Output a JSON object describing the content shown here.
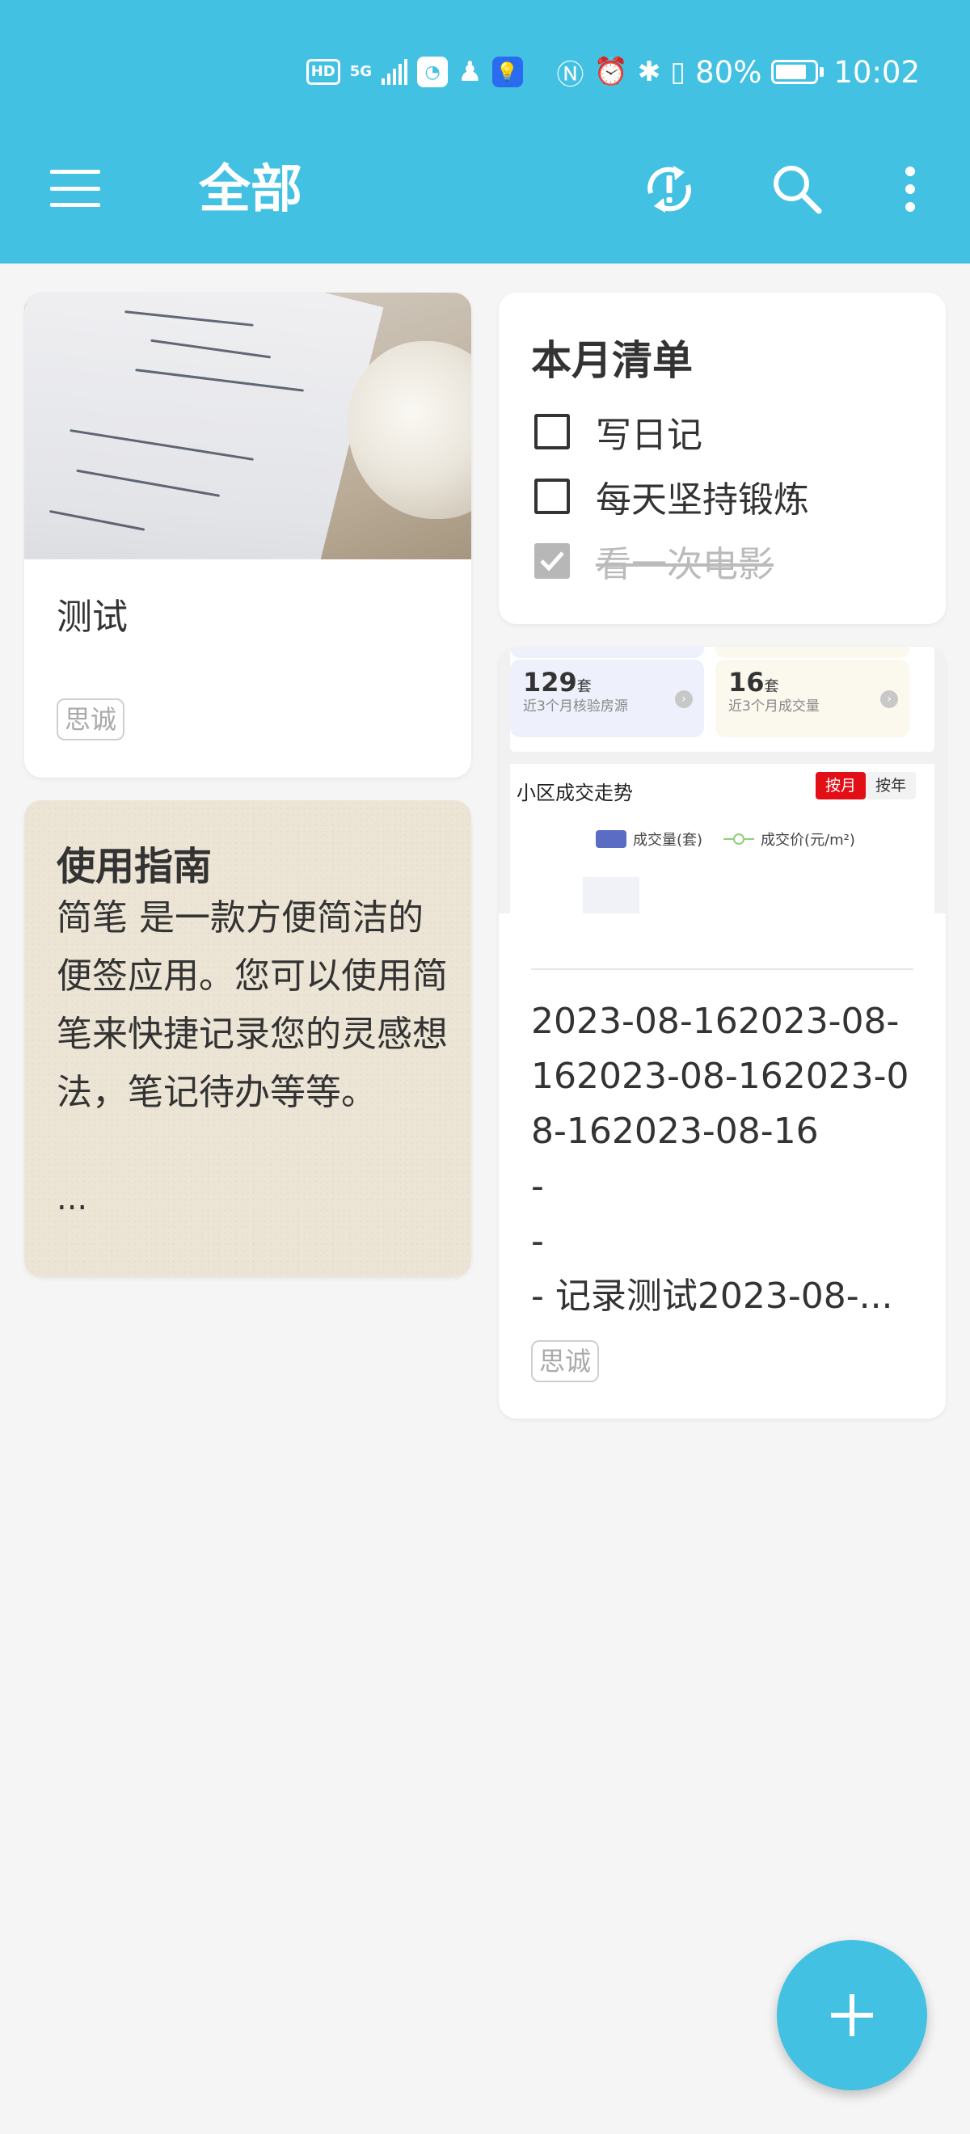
{
  "status_bar": {
    "hd": "HD",
    "network": "5G",
    "battery_percent": "80%",
    "battery_level": 0.8,
    "time": "10:02"
  },
  "toolbar": {
    "title": "全部",
    "icons": [
      "menu-icon",
      "sync-alert-icon",
      "search-icon",
      "more-vertical-icon"
    ]
  },
  "notes": {
    "test": {
      "title": "测试",
      "tag": "思诚"
    },
    "guide": {
      "title": "使用指南",
      "body": "简笔 是一款方便简洁的便签应用。您可以使用简笔来快捷记录您的灵感想法，笔记待办等等。",
      "more": "..."
    },
    "checklist": {
      "title": "本月清单",
      "items": [
        {
          "label": "写日记",
          "checked": false
        },
        {
          "label": "每天坚持锻炼",
          "checked": false
        },
        {
          "label": "看一次电影",
          "checked": true
        }
      ]
    },
    "record": {
      "screenshot": {
        "stat1_number": "129",
        "stat1_unit": "套",
        "stat1_label": "近3个月核验房源",
        "stat2_number": "16",
        "stat2_unit": "套",
        "stat2_label": "近3个月成交量",
        "chart_title": "小区成交走势",
        "toggle_month": "按月",
        "toggle_year": "按年",
        "legend_volume": "成交量(套)",
        "legend_price": "成交价(元/m²)"
      },
      "text": "2023-08-162023-08-162023-08-162023-08-162023-08-16\n-\n-\n- 记录测试2023-08-...",
      "tag": "思诚"
    }
  },
  "fab": {
    "icon": "plus-icon",
    "color": "#42c1e2"
  },
  "colors": {
    "accent": "#42c1e2",
    "background": "#f5f5f5"
  }
}
